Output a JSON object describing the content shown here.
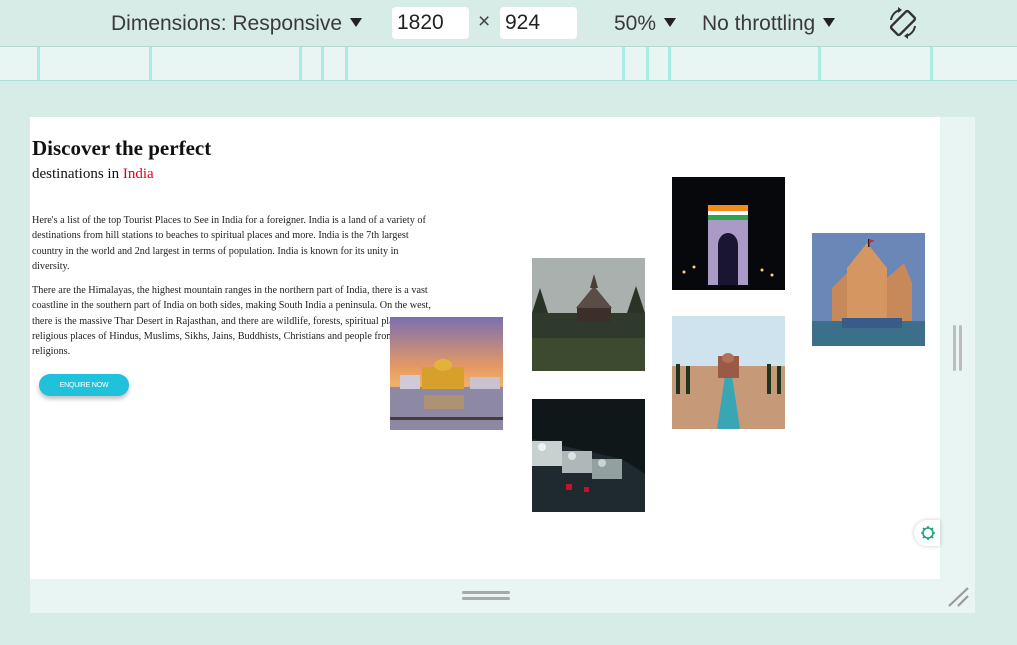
{
  "toolbar": {
    "dimensions_label": "Dimensions: Responsive",
    "width_value": "1820",
    "times_symbol": "×",
    "height_value": "924",
    "zoom_label": "50%",
    "throttling_label": "No throttling",
    "rotate_icon": "rotate-device-icon"
  },
  "page": {
    "heading": "Discover the perfect",
    "subheading_prefix": "destinations in ",
    "subheading_accent": "India",
    "accent_color": "#e3001b",
    "paragraph1": "Here's a list of the top Tourist Places to See in India for a foreigner. India is a land of a variety of destinations from hill stations to beaches to spiritual places and more. India is the 7th largest country in the world and 2nd largest in terms of population. India is known for its unity in diversity.",
    "paragraph2": "There are the Himalayas, the highest mountain ranges in the northern part of India, there is a vast coastline in the southern part of India on both sides, making South India a peninsula. On the west, there is the massive Thar Desert in Rajasthan, and there are wildlife, forests, spiritual places, religious places of Hindus, Muslims, Sikhs, Jains, Buddhists, Christians and people from other religions.",
    "button_label": "ENQUIRE NOW",
    "button_color": "#1fc2da",
    "photos": [
      "golden-temple-photo",
      "hill-temple-photo",
      "palace-at-night-photo",
      "india-gate-photo",
      "taj-mahal-photo",
      "stone-temple-photo"
    ]
  }
}
